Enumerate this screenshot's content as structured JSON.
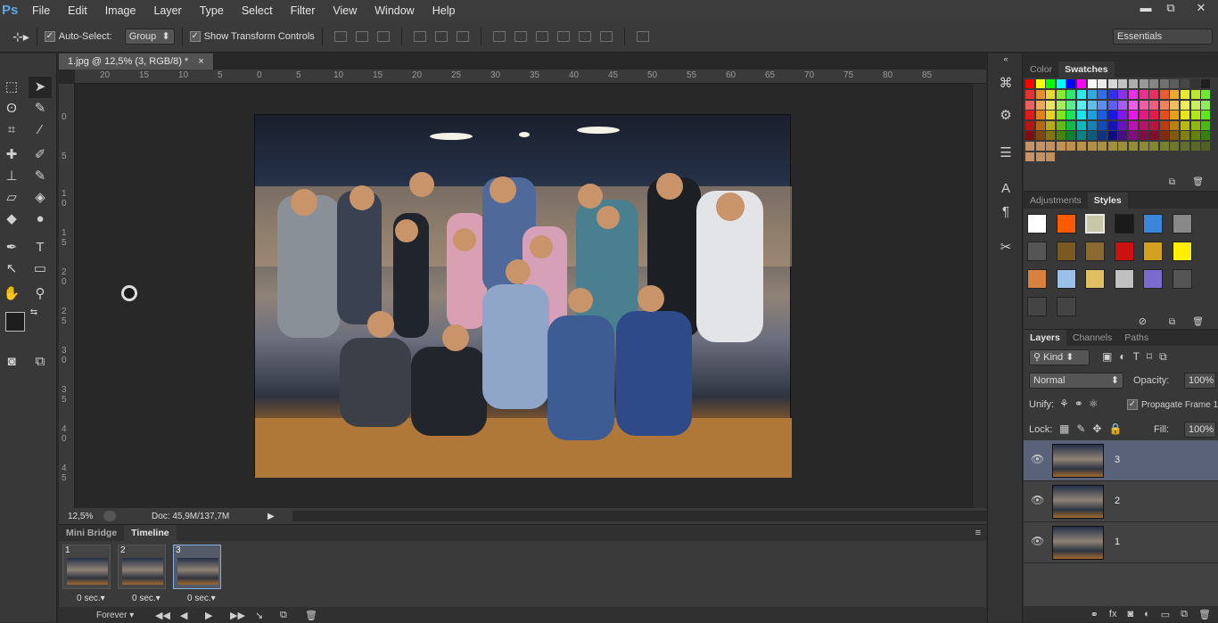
{
  "app": {
    "logo": "Ps"
  },
  "menu": [
    "File",
    "Edit",
    "Image",
    "Layer",
    "Type",
    "Select",
    "Filter",
    "View",
    "Window",
    "Help"
  ],
  "window_controls": {
    "minimize": "▬",
    "restore": "⧉",
    "close": "✕"
  },
  "options": {
    "auto_select_label": "Auto-Select:",
    "group_select": "Group",
    "show_transform_label": "Show Transform Controls",
    "workspace": "Essentials"
  },
  "document": {
    "tab_title": "1.jpg @ 12,5% (3, RGB/8) *",
    "tab_close": "×",
    "zoom": "12,5%",
    "doc_info": "Doc: 45,9M/137,7M"
  },
  "ruler": {
    "h_labels": [
      "20",
      "15",
      "10",
      "5",
      "0",
      "5",
      "10",
      "15",
      "20",
      "25",
      "30",
      "35",
      "40",
      "45",
      "50",
      "55",
      "60",
      "65",
      "70",
      "75",
      "80",
      "85"
    ],
    "v_labels": [
      "0",
      "5",
      "1 0",
      "1 5",
      "2 0",
      "2 5",
      "3 0",
      "3 5",
      "4 0",
      "4 5"
    ]
  },
  "timeline": {
    "tabs": [
      "Mini Bridge",
      "Timeline"
    ],
    "active_tab": "Timeline",
    "frames": [
      {
        "num": "1",
        "delay": "0 sec.▾"
      },
      {
        "num": "2",
        "delay": "0 sec.▾"
      },
      {
        "num": "3",
        "delay": "0 sec.▾"
      }
    ],
    "loop": "Forever"
  },
  "panels": {
    "color_tabs": [
      "Color",
      "Swatches"
    ],
    "color_active": "Swatches",
    "adj_tabs": [
      "Adjustments",
      "Styles"
    ],
    "adj_active": "Styles",
    "layers_tabs": [
      "Layers",
      "Channels",
      "Paths"
    ],
    "layers_active": "Layers",
    "kind_label": "Kind",
    "blend_mode": "Normal",
    "opacity_label": "Opacity:",
    "opacity_value": "100%",
    "unify_label": "Unify:",
    "propagate_label": "Propagate Frame 1",
    "lock_label": "Lock:",
    "fill_label": "Fill:",
    "fill_value": "100%",
    "layers": [
      {
        "name": "3",
        "selected": true
      },
      {
        "name": "2",
        "selected": false
      },
      {
        "name": "1",
        "selected": false
      }
    ]
  },
  "colors": {
    "accent": "#5aa7e8",
    "foreground": "#1e1e1e",
    "background": "#ffffff"
  }
}
